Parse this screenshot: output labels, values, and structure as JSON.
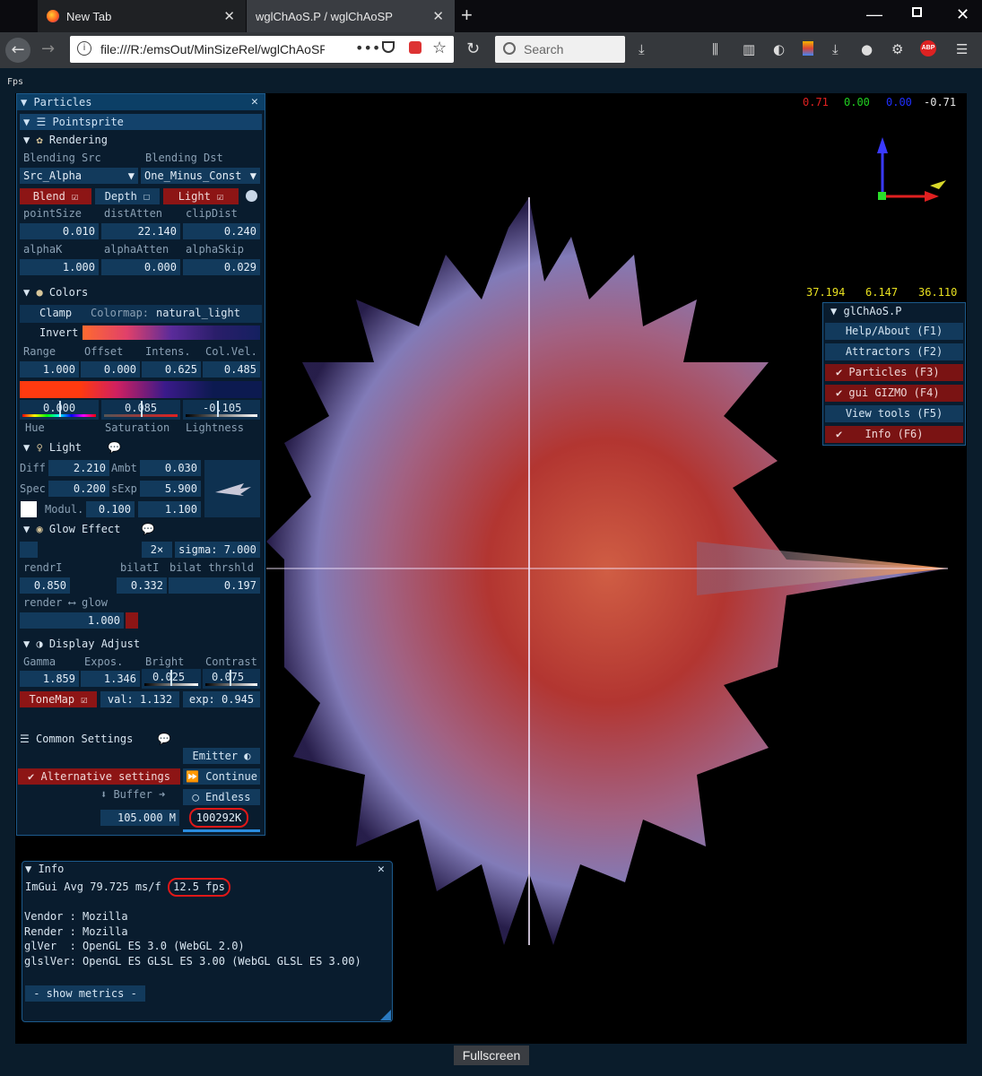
{
  "browser": {
    "tabs": [
      {
        "label": "New Tab"
      },
      {
        "label": "wglChAoS.P / wglChAoSP"
      }
    ],
    "url": "file:///R:/emsOut/MinSizeRel/wglChAoSP",
    "search_placeholder": "Search",
    "fullscreen_label": "Fullscreen",
    "abp_label": "ABP"
  },
  "fps_corner": "Fps",
  "viewport": {
    "rgb_readout": {
      "r": "0.71",
      "g": "0.00",
      "b": "0.00",
      "a": "-0.71"
    },
    "pos_readout": {
      "x": "37.194",
      "y": "6.147",
      "z": "36.110"
    }
  },
  "particles_panel": {
    "title": "Particles",
    "pointsprite_label": "Pointsprite",
    "rendering": {
      "label": "Rendering",
      "blend_src_label": "Blending Src",
      "blend_dst_label": "Blending Dst",
      "blend_src_value": "Src_Alpha",
      "blend_dst_value": "One_Minus_Const",
      "blend_label": "Blend",
      "depth_label": "Depth",
      "light_label": "Light",
      "row1_labels": [
        "pointSize",
        "distAtten",
        "clipDist"
      ],
      "row1_values": [
        "0.010",
        "22.140",
        "0.240"
      ],
      "row2_labels": [
        "alphaK",
        "alphaAtten",
        "alphaSkip"
      ],
      "row2_values": [
        "1.000",
        "0.000",
        "0.029"
      ]
    },
    "colors": {
      "label": "Colors",
      "clamp_label": "Clamp",
      "colormap_label": "Colormap:",
      "colormap_value": "natural_light",
      "invert_label": "Invert",
      "labels": [
        "Range",
        "Offset",
        "Intens.",
        "Col.Vel."
      ],
      "values": [
        "1.000",
        "0.000",
        "0.625",
        "0.485"
      ],
      "slider_values": [
        "0.000",
        "0.085",
        "-0.105"
      ],
      "slider_labels": [
        "Hue",
        "Saturation",
        "Lightness"
      ]
    },
    "light": {
      "label": "Light",
      "diff_label": "Diff",
      "diff_value": "2.210",
      "ambt_label": "Ambt",
      "ambt_value": "0.030",
      "spec_label": "Spec",
      "spec_value": "0.200",
      "sexp_label": "sExp",
      "sexp_value": "5.900",
      "modul_label": "Modul.",
      "modul_value": "0.100",
      "modul_value2": "1.100"
    },
    "glow": {
      "label": "Glow Effect",
      "mult_label": "2×",
      "sigma_label": "sigma: 7.000",
      "labels": [
        "rendrI",
        "bilatI",
        "bilat thrshld"
      ],
      "values": [
        "0.850",
        "0.332",
        "0.197"
      ],
      "mix_label": "render ⟷ glow",
      "mix_value": "1.000"
    },
    "display": {
      "label": "Display Adjust",
      "labels": [
        "Gamma",
        "Expos.",
        "Bright",
        "Contrast"
      ],
      "values": [
        "1.859",
        "1.346",
        "0.025",
        "0.075"
      ],
      "tonemap_label": "ToneMap",
      "val_label": "val: 1.132",
      "exp_label": "exp: 0.945"
    },
    "common": {
      "label": "Common Settings",
      "emitter_label": "Emitter",
      "alt_label": "Alternative settings",
      "continue_label": "Continue",
      "buffer_label": "Buffer",
      "endless_label": "Endless",
      "buffer_value": "105.000 M",
      "count_value": "100292K"
    }
  },
  "right_menu": {
    "title": "glChAoS.P",
    "items": [
      {
        "label": "Help/About (F1)",
        "checked": false
      },
      {
        "label": "Attractors (F2)",
        "checked": false
      },
      {
        "label": "Particles (F3)",
        "checked": true
      },
      {
        "label": "gui GIZMO (F4)",
        "checked": true
      },
      {
        "label": "View tools (F5)",
        "checked": false
      },
      {
        "label": "Info (F6)",
        "checked": true
      }
    ]
  },
  "info_panel": {
    "title": "Info",
    "avg": "ImGui Avg 79.725 ms/f",
    "fps": "12.5 fps",
    "lines": [
      "Vendor : Mozilla",
      "Render : Mozilla",
      "glVer  : OpenGL ES 3.0 (WebGL 2.0)",
      "glslVer: OpenGL ES GLSL ES 3.00 (WebGL GLSL ES 3.00)"
    ],
    "metrics_label": "- show metrics -"
  },
  "colors": {
    "accent": "#0c3f66",
    "red": "#8d1515",
    "panel_bg": "#0a1e32"
  }
}
